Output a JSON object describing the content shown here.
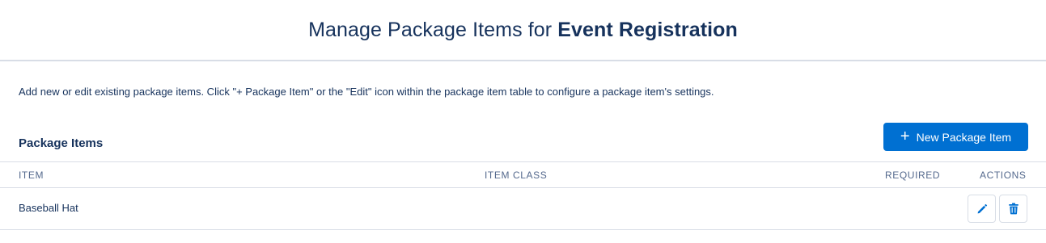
{
  "header": {
    "title_prefix": "Manage Package Items for",
    "title_bold": "Event Registration"
  },
  "description": "Add new or edit existing package items. Click \"+ Package Item\" or the \"Edit\" icon within the package item table to configure a package item's settings.",
  "section": {
    "title": "Package Items",
    "new_button_plus": "+",
    "new_button_label": "New Package Item"
  },
  "table": {
    "columns": [
      "ITEM",
      "ITEM CLASS",
      "REQUIRED",
      "ACTIONS"
    ],
    "rows": [
      {
        "item": "Baseball Hat",
        "item_class": "",
        "required": "",
        "actions": [
          "pencil-icon",
          "trash-icon"
        ]
      }
    ]
  },
  "colors": {
    "primary": "#0070d2",
    "text": "#16325c",
    "header_text": "#54698d",
    "border": "#d8dde6"
  }
}
